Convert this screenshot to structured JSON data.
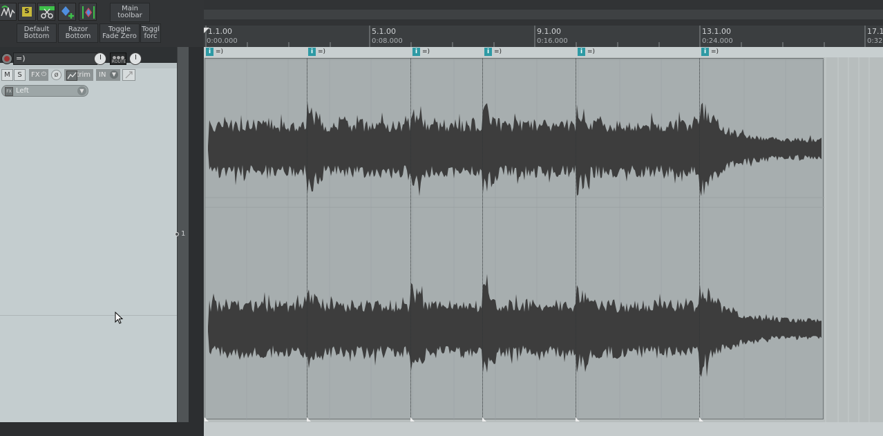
{
  "toolbar": {
    "buttons": [
      {
        "icon": "envelope-wave-icon"
      },
      {
        "icon": "solo-icon",
        "label": "S"
      },
      {
        "icon": "scissors-icon"
      },
      {
        "icon": "add-marker-icon"
      },
      {
        "icon": "marker-range-icon"
      }
    ],
    "main_toolbar": "Main\ntoolbar",
    "row2": [
      "Default\nBottom",
      "Razor\nBottom",
      "Toggle\nFade Zero",
      "Toggl\nforc"
    ]
  },
  "track": {
    "name": "=)",
    "route_label": "ROUTE",
    "mute": "M",
    "solo": "S",
    "fx": "FX",
    "trim": "trim",
    "in": "IN",
    "number": "1",
    "envelope": "Left"
  },
  "ruler": {
    "ticks": [
      {
        "bar": "1.1.00",
        "time": "0:00.000"
      },
      {
        "bar": "5.1.00",
        "time": "0:08.000"
      },
      {
        "bar": "9.1.00",
        "time": "0:16.000"
      },
      {
        "bar": "13.1.00",
        "time": "0:24.000"
      },
      {
        "bar": "17.1",
        "time": "0:32."
      }
    ]
  },
  "markers": [
    {
      "id": "i",
      "name": "=)"
    },
    {
      "id": "i",
      "name": "=)"
    },
    {
      "id": "i",
      "name": "=)"
    },
    {
      "id": "i",
      "name": "=)"
    },
    {
      "id": "i",
      "name": "=)"
    },
    {
      "id": "i",
      "name": "=)"
    }
  ],
  "colors": {
    "waveform": "#3d3d3d",
    "marker": "#2e9aa4",
    "item_bg": "#a7aeaf",
    "green_icon": "#3ec04a"
  }
}
